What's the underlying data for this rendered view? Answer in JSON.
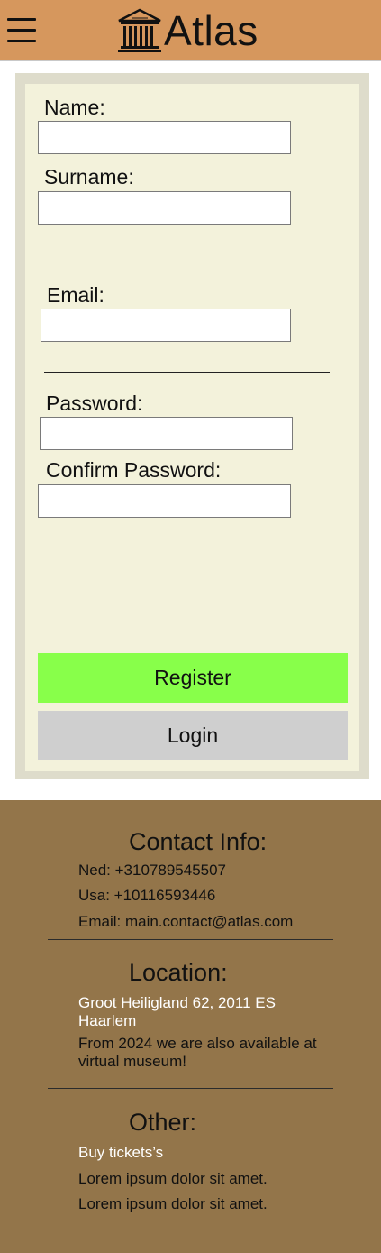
{
  "header": {
    "brand": "Atlas",
    "menu_icon": "hamburger-menu-icon",
    "logo_icon": "museum-building-icon",
    "background_color": "#D6975D"
  },
  "form": {
    "name_label": "Name:",
    "surname_label": "Surname:",
    "email_label": "Email:",
    "password_label": "Password:",
    "confirm_password_label": "Confirm Password:",
    "name_value": "",
    "surname_value": "",
    "email_value": "",
    "password_value": "",
    "confirm_password_value": "",
    "register_label": "Register",
    "login_label": "Login",
    "register_color": "#88FF4A",
    "login_color": "#CFCFCF"
  },
  "footer": {
    "background_color": "#93754A",
    "contact": {
      "heading": "Contact Info:",
      "ned": "Ned: +310789545507",
      "usa": "Usa: +10116593446",
      "email": "Email: main.contact@atlas.com"
    },
    "location": {
      "heading": "Location:",
      "address": "Groot Heiligland 62, 2011 ES Haarlem",
      "note": "From 2024 we are also available at virtual museum!"
    },
    "other": {
      "heading": "Other:",
      "buy_tickets": "Buy tickets’s",
      "lorem_1": "Lorem ipsum dolor sit amet.",
      "lorem_2": "Lorem ipsum dolor sit amet."
    }
  }
}
